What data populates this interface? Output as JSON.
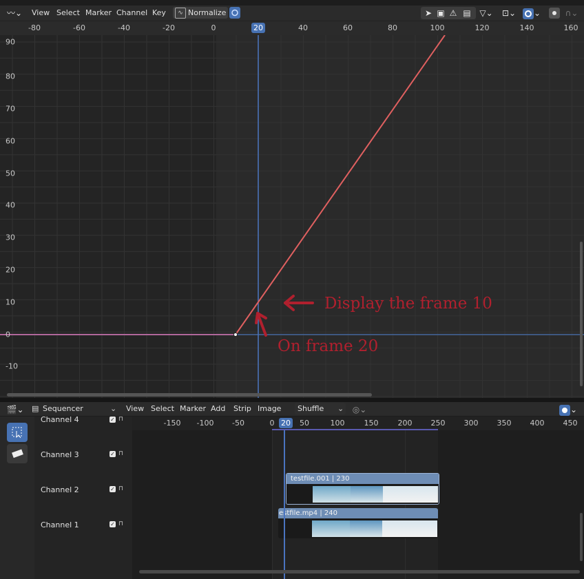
{
  "graph_editor": {
    "menu": [
      "View",
      "Select",
      "Marker",
      "Channel",
      "Key"
    ],
    "normalize_label": "Normalize",
    "icons": {
      "editor_type": "graph-editor-icon",
      "normalize": "normalize-icon",
      "sync": "sync-icon",
      "cursor": "cursor-icon",
      "frame": "frame-select-icon",
      "warning": "warning-icon",
      "pin": "pin-icon",
      "filter": "filter-icon",
      "pivot": "pivot-icon",
      "snap": "snap-icon",
      "proportional": "proportional-edit-icon",
      "falloff": "falloff-icon"
    },
    "x_ticks": [
      "-80",
      "-60",
      "-40",
      "-20",
      "0",
      "40",
      "60",
      "80",
      "100",
      "120",
      "140",
      "160"
    ],
    "current_frame": "20",
    "y_ticks": [
      "90",
      "80",
      "70",
      "60",
      "50",
      "40",
      "30",
      "20",
      "10",
      "0",
      "-10"
    ],
    "curve": {
      "color": "#e06060",
      "points": [
        [
          10,
          0
        ],
        [
          100,
          90
        ]
      ]
    },
    "annotations": {
      "display_frame": "Display the frame 10",
      "on_frame": "On frame 20",
      "color": "#b0202e"
    }
  },
  "sequencer": {
    "mode_label": "Sequencer",
    "menu": [
      "View",
      "Select",
      "Marker",
      "Add",
      "Strip",
      "Image"
    ],
    "shuffle_label": "Shuffle",
    "current_frame": "20",
    "x_ticks": [
      "-150",
      "-100",
      "-50",
      "0",
      "50",
      "100",
      "150",
      "200",
      "250",
      "300",
      "350",
      "400",
      "450"
    ],
    "channels": [
      {
        "label": "Channel 4",
        "checked": true
      },
      {
        "label": "Channel 3",
        "checked": true
      },
      {
        "label": "Channel 2",
        "checked": true
      },
      {
        "label": "Channel 1",
        "checked": true
      }
    ],
    "strips": [
      {
        "label": "testfile.001 | 230",
        "channel": 2
      },
      {
        "label": "estfile.mp4 | 240",
        "channel": 1
      }
    ],
    "icons": {
      "editor_type": "sequencer-icon",
      "select_tool": "select-box-icon",
      "blade_tool": "blade-icon",
      "overlay": "overlay-icon"
    }
  }
}
